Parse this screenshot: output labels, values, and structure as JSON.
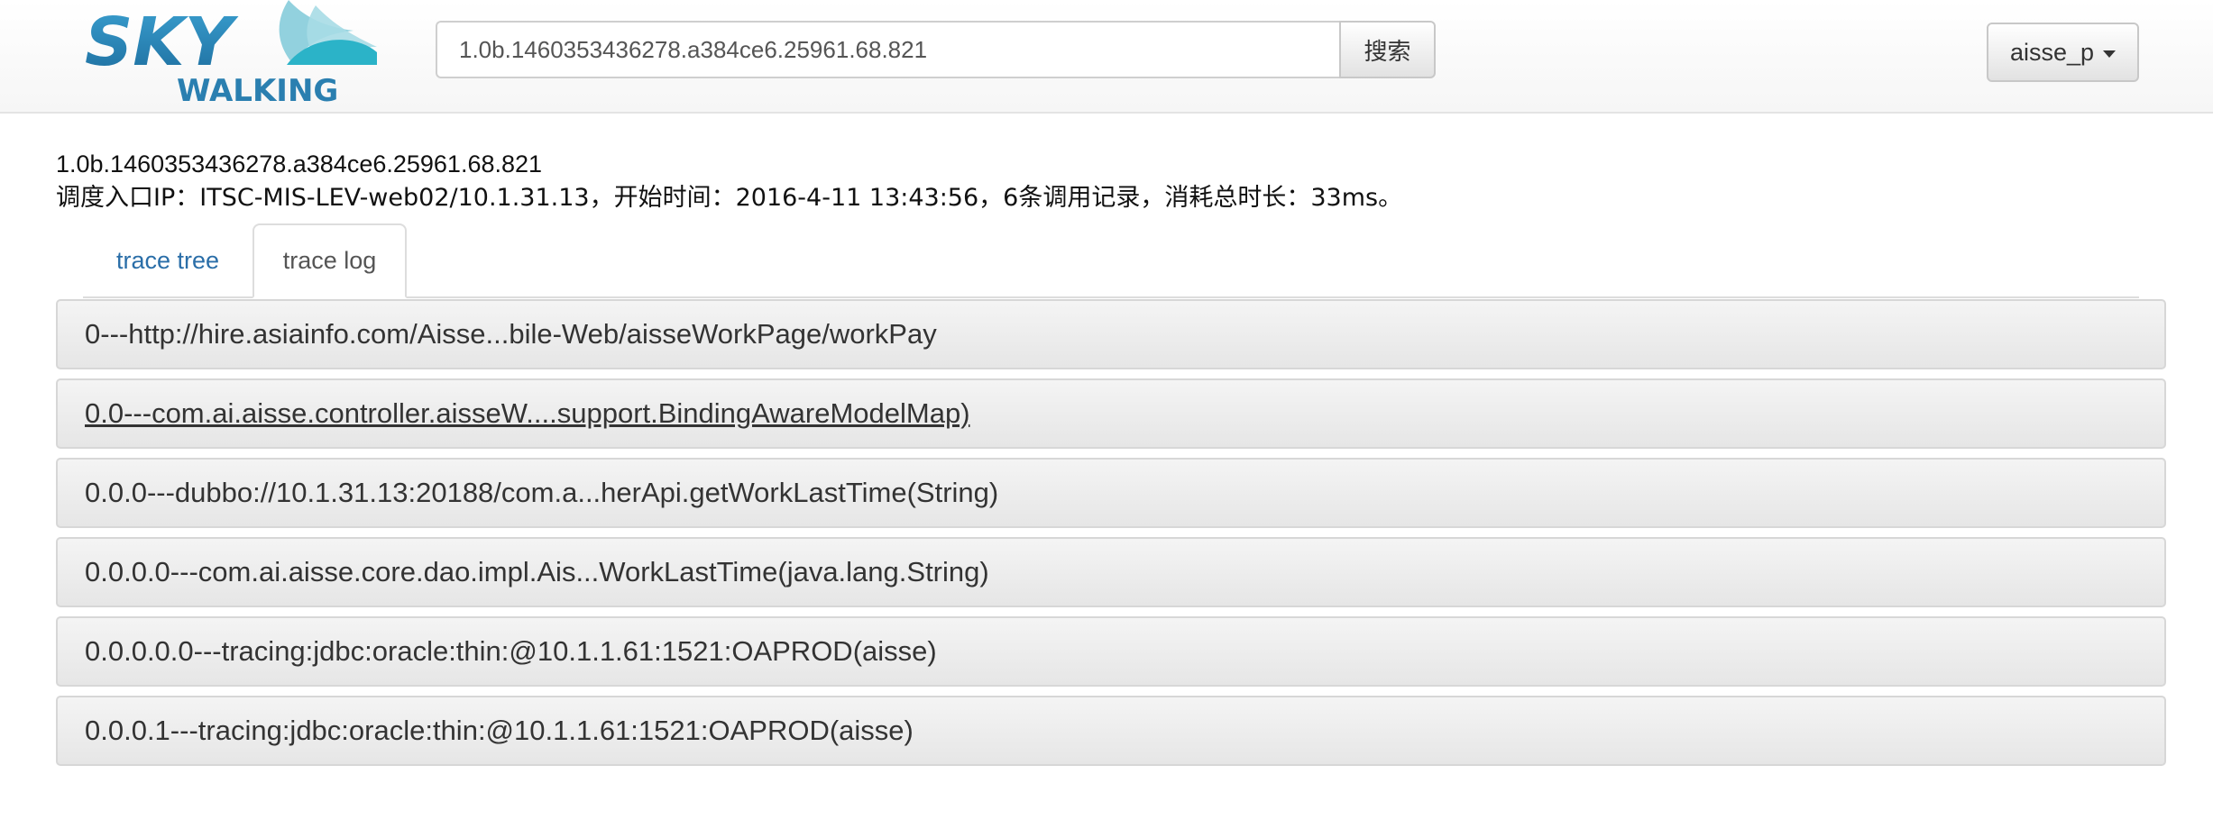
{
  "logo": {
    "top_text": "SKY",
    "bottom_text": "WALKING"
  },
  "search": {
    "value": "1.0b.1460353436278.a384ce6.25961.68.821",
    "button_label": "搜索"
  },
  "user_menu": {
    "label": "aisse_p"
  },
  "trace": {
    "id": "1.0b.1460353436278.a384ce6.25961.68.821",
    "summary": "调度入口IP：ITSC-MIS-LEV-web02/10.1.31.13，开始时间：2016-4-11 13:43:56，6条调用记录，消耗总时长：33ms。"
  },
  "tabs": [
    {
      "label": "trace tree",
      "active": false
    },
    {
      "label": "trace log",
      "active": true
    }
  ],
  "trace_log": [
    {
      "label": "0---http://hire.asiainfo.com/Aisse...bile-Web/aisseWorkPage/workPay"
    },
    {
      "label": "0.0---com.ai.aisse.controller.aisseW....support.BindingAwareModelMap)"
    },
    {
      "label": "0.0.0---dubbo://10.1.31.13:20188/com.a...herApi.getWorkLastTime(String)"
    },
    {
      "label": "0.0.0.0---com.ai.aisse.core.dao.impl.Ais...WorkLastTime(java.lang.String)"
    },
    {
      "label": "0.0.0.0.0---tracing:jdbc:oracle:thin:@10.1.1.61:1521:OAPROD(aisse)"
    },
    {
      "label": "0.0.0.1---tracing:jdbc:oracle:thin:@10.1.1.61:1521:OAPROD(aisse)"
    }
  ],
  "colors": {
    "logo_blue": "#2a7fb0",
    "logo_teal": "#2bb3c8",
    "link": "#2a6ea8"
  }
}
